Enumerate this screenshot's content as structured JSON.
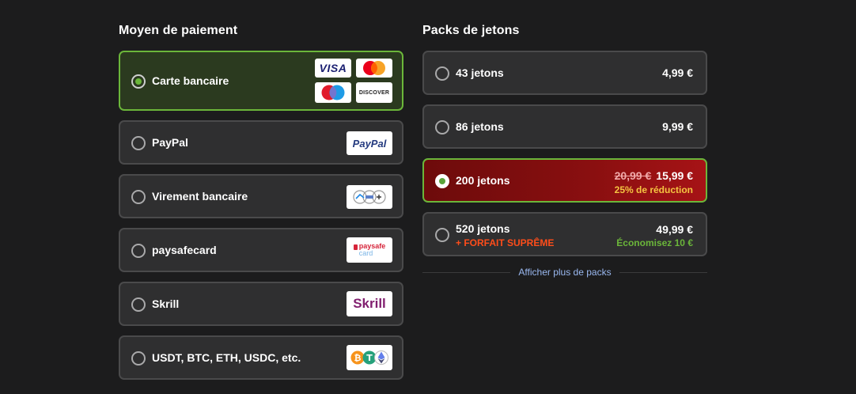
{
  "payment": {
    "title": "Moyen de paiement",
    "options": [
      {
        "label": "Carte bancaire",
        "selected": true,
        "logos": [
          "VISA",
          "mastercard",
          "maestro",
          "DISCOVER"
        ]
      },
      {
        "label": "PayPal",
        "selected": false,
        "logo": "PayPal"
      },
      {
        "label": "Virement bancaire",
        "selected": false,
        "logo": "bank-transfer-logo"
      },
      {
        "label": "paysafecard",
        "selected": false,
        "logo": "paysafecard"
      },
      {
        "label": "Skrill",
        "selected": false,
        "logo": "Skrill"
      },
      {
        "label": "USDT, BTC, ETH, USDC, etc.",
        "selected": false,
        "logo": "crypto-logo"
      }
    ],
    "logo_text": {
      "visa": "VISA",
      "discover": "DISCOVER",
      "paypal": "PayPal",
      "paysafe": "paysafe",
      "paysafe_card": "card",
      "skrill": "Skrill"
    }
  },
  "packs": {
    "title": "Packs de jetons",
    "items": [
      {
        "label": "43 jetons",
        "price": "4,99 €",
        "selected": false
      },
      {
        "label": "86 jetons",
        "price": "9,99 €",
        "selected": false
      },
      {
        "label": "200 jetons",
        "old_price": "20,99 €",
        "price": "15,99 €",
        "discount": "25% de réduction",
        "selected": true
      },
      {
        "label": "520 jetons",
        "price": "49,99 €",
        "tag": "+ FORFAIT SUPRÊME",
        "savings": "Économisez 10 €",
        "selected": false
      }
    ],
    "more_link": "Afficher plus de packs"
  },
  "colors": {
    "background": "#1c1c1d",
    "card": "#2f2f30",
    "selected_border": "#6bb63a",
    "selected_red": "#8a0f10",
    "discount_yellow": "#f5c542",
    "tag_orange": "#ff4d1a",
    "savings_green": "#6bb63a",
    "link_blue": "#9ab8f0"
  }
}
